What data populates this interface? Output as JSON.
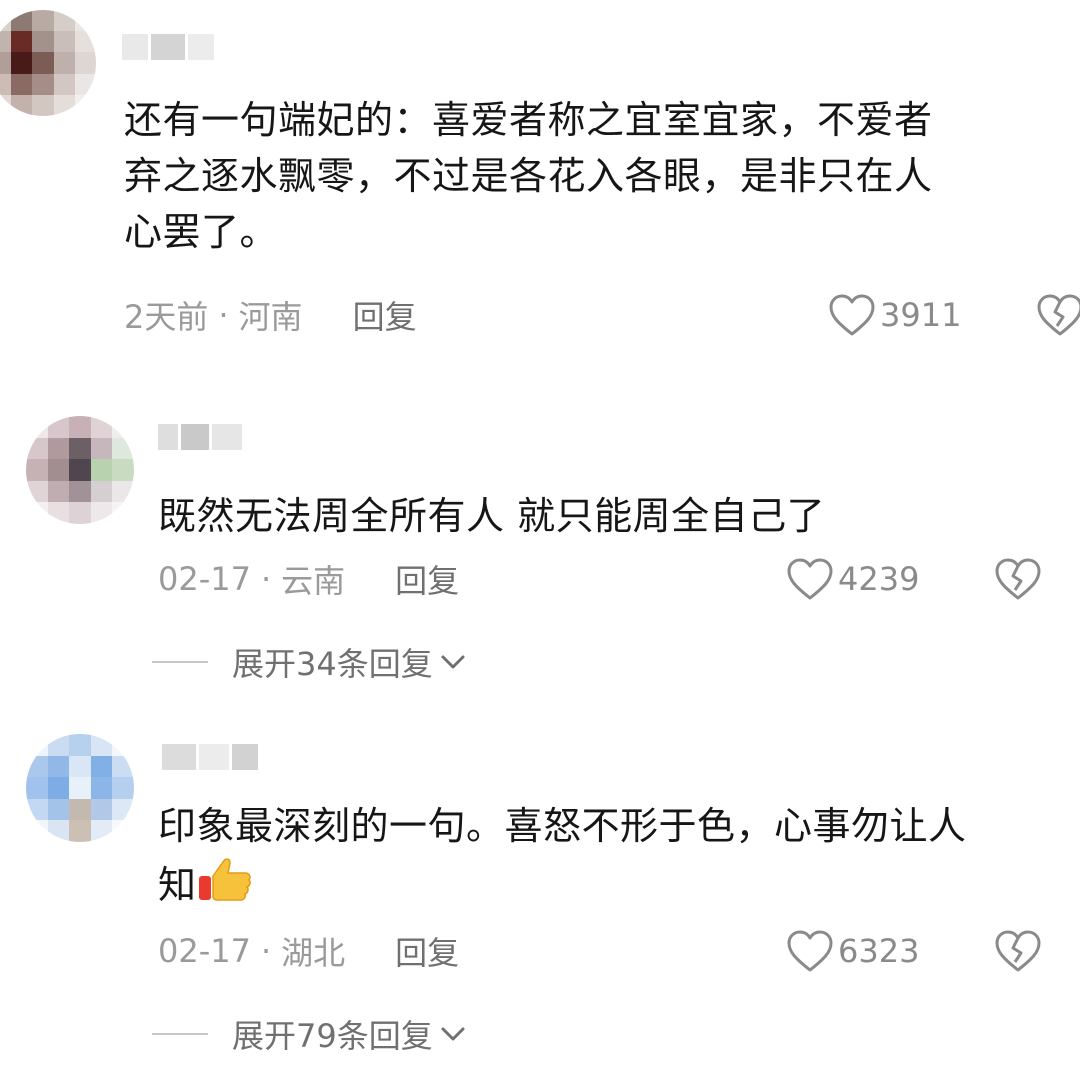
{
  "comments": [
    {
      "text": "还有一句端妃的：喜爱者称之宜室宜家，不爱者\n弃之逐水飘零，不过是各花入各眼，是非只在人\n心罢了。",
      "date": "2天前",
      "location": "河南",
      "reply_label": "回复",
      "likes": "3911"
    },
    {
      "text": "既然无法周全所有人 就只能周全自己了",
      "date": "02-17",
      "location": "云南",
      "reply_label": "回复",
      "likes": "4239",
      "expand_label": "展开34条回复"
    },
    {
      "text_line1": "印象最深刻的一句。喜怒不形于色，心事勿让人",
      "text_line2": "知",
      "emoji": "thumbs-up-icon",
      "date": "02-17",
      "location": "湖北",
      "reply_label": "回复",
      "likes": "6323",
      "expand_label": "展开79条回复"
    }
  ],
  "separator": "·",
  "colors": {
    "meta_gray": "#9a9a9a",
    "text_dark": "#161616",
    "icon_gray": "#8a8a8a"
  }
}
